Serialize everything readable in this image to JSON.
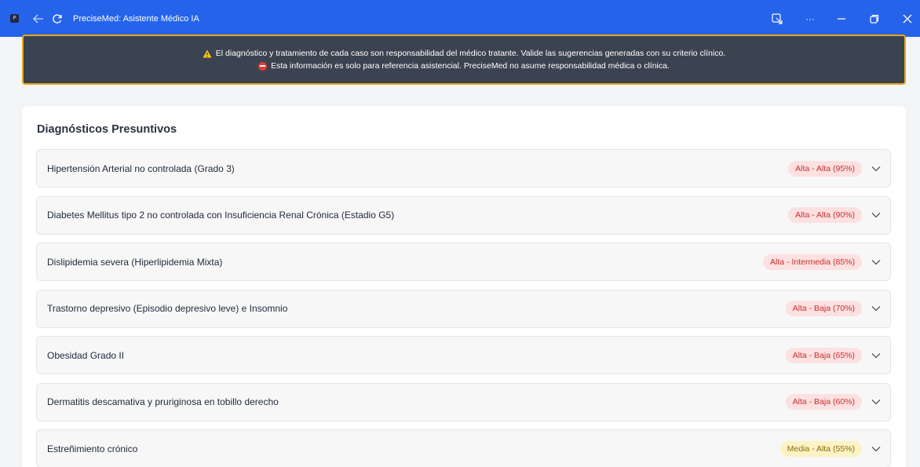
{
  "window": {
    "title": "PreciseMed: Asistente Médico IA",
    "app_icon_glyph": "P",
    "more_glyph": "···"
  },
  "banner": {
    "warning": "El diagnóstico y tratamiento de cada caso son responsabilidad del médico tratante. Valide las sugerencias generadas con su criterio clínico.",
    "info": "Esta información es solo para referencia asistencial. PreciseMed no asume responsabilidad médica o clínica.",
    "border_color": "#e6a817",
    "background": "#3c4350"
  },
  "diagnoses": {
    "title": "Diagnósticos Presuntivos",
    "items": [
      {
        "label": "Hipertensión Arterial no controlada (Grado 3)",
        "badge": "Alta - Alta (95%)",
        "level": "alta"
      },
      {
        "label": "Diabetes Mellitus tipo 2 no controlada con Insuficiencia Renal Crónica (Estadio G5)",
        "badge": "Alta - Alta (90%)",
        "level": "alta"
      },
      {
        "label": "Dislipidemia severa (Hiperlipidemia Mixta)",
        "badge": "Alta - Intermedia (85%)",
        "level": "alta"
      },
      {
        "label": "Trastorno depresivo (Episodio depresivo leve) e Insomnio",
        "badge": "Alta - Baja (70%)",
        "level": "alta"
      },
      {
        "label": "Obesidad Grado II",
        "badge": "Alta - Baja (65%)",
        "level": "alta"
      },
      {
        "label": "Dermatitis descamativa y pruriginosa en tobillo derecho",
        "badge": "Alta - Baja (60%)",
        "level": "alta"
      },
      {
        "label": "Estreñimiento crónico",
        "badge": "Media - Alta (55%)",
        "level": "media"
      }
    ]
  },
  "colors": {
    "titlebar": "#2563eb",
    "badge_alta_bg": "#fde0e0",
    "badge_alta_text": "#c53030",
    "badge_media_bg": "#fdf3c4",
    "badge_media_text": "#8a6d12"
  }
}
